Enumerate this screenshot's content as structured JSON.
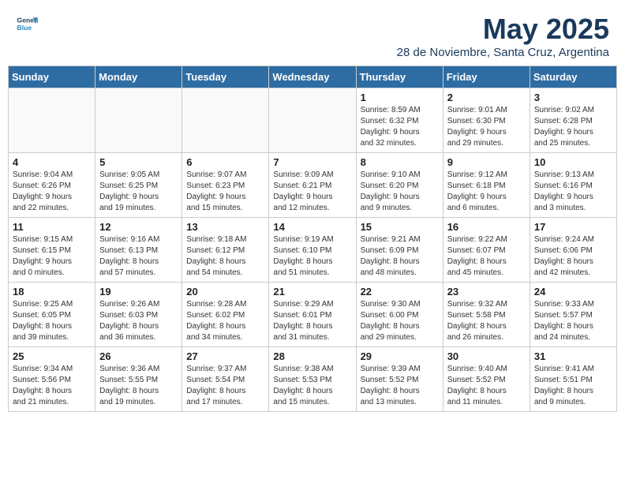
{
  "header": {
    "logo_line1": "General",
    "logo_line2": "Blue",
    "title": "May 2025",
    "location": "28 de Noviembre, Santa Cruz, Argentina"
  },
  "days_of_week": [
    "Sunday",
    "Monday",
    "Tuesday",
    "Wednesday",
    "Thursday",
    "Friday",
    "Saturday"
  ],
  "weeks": [
    [
      {
        "day": "",
        "info": ""
      },
      {
        "day": "",
        "info": ""
      },
      {
        "day": "",
        "info": ""
      },
      {
        "day": "",
        "info": ""
      },
      {
        "day": "1",
        "info": "Sunrise: 8:59 AM\nSunset: 6:32 PM\nDaylight: 9 hours\nand 32 minutes."
      },
      {
        "day": "2",
        "info": "Sunrise: 9:01 AM\nSunset: 6:30 PM\nDaylight: 9 hours\nand 29 minutes."
      },
      {
        "day": "3",
        "info": "Sunrise: 9:02 AM\nSunset: 6:28 PM\nDaylight: 9 hours\nand 25 minutes."
      }
    ],
    [
      {
        "day": "4",
        "info": "Sunrise: 9:04 AM\nSunset: 6:26 PM\nDaylight: 9 hours\nand 22 minutes."
      },
      {
        "day": "5",
        "info": "Sunrise: 9:05 AM\nSunset: 6:25 PM\nDaylight: 9 hours\nand 19 minutes."
      },
      {
        "day": "6",
        "info": "Sunrise: 9:07 AM\nSunset: 6:23 PM\nDaylight: 9 hours\nand 15 minutes."
      },
      {
        "day": "7",
        "info": "Sunrise: 9:09 AM\nSunset: 6:21 PM\nDaylight: 9 hours\nand 12 minutes."
      },
      {
        "day": "8",
        "info": "Sunrise: 9:10 AM\nSunset: 6:20 PM\nDaylight: 9 hours\nand 9 minutes."
      },
      {
        "day": "9",
        "info": "Sunrise: 9:12 AM\nSunset: 6:18 PM\nDaylight: 9 hours\nand 6 minutes."
      },
      {
        "day": "10",
        "info": "Sunrise: 9:13 AM\nSunset: 6:16 PM\nDaylight: 9 hours\nand 3 minutes."
      }
    ],
    [
      {
        "day": "11",
        "info": "Sunrise: 9:15 AM\nSunset: 6:15 PM\nDaylight: 9 hours\nand 0 minutes."
      },
      {
        "day": "12",
        "info": "Sunrise: 9:16 AM\nSunset: 6:13 PM\nDaylight: 8 hours\nand 57 minutes."
      },
      {
        "day": "13",
        "info": "Sunrise: 9:18 AM\nSunset: 6:12 PM\nDaylight: 8 hours\nand 54 minutes."
      },
      {
        "day": "14",
        "info": "Sunrise: 9:19 AM\nSunset: 6:10 PM\nDaylight: 8 hours\nand 51 minutes."
      },
      {
        "day": "15",
        "info": "Sunrise: 9:21 AM\nSunset: 6:09 PM\nDaylight: 8 hours\nand 48 minutes."
      },
      {
        "day": "16",
        "info": "Sunrise: 9:22 AM\nSunset: 6:07 PM\nDaylight: 8 hours\nand 45 minutes."
      },
      {
        "day": "17",
        "info": "Sunrise: 9:24 AM\nSunset: 6:06 PM\nDaylight: 8 hours\nand 42 minutes."
      }
    ],
    [
      {
        "day": "18",
        "info": "Sunrise: 9:25 AM\nSunset: 6:05 PM\nDaylight: 8 hours\nand 39 minutes."
      },
      {
        "day": "19",
        "info": "Sunrise: 9:26 AM\nSunset: 6:03 PM\nDaylight: 8 hours\nand 36 minutes."
      },
      {
        "day": "20",
        "info": "Sunrise: 9:28 AM\nSunset: 6:02 PM\nDaylight: 8 hours\nand 34 minutes."
      },
      {
        "day": "21",
        "info": "Sunrise: 9:29 AM\nSunset: 6:01 PM\nDaylight: 8 hours\nand 31 minutes."
      },
      {
        "day": "22",
        "info": "Sunrise: 9:30 AM\nSunset: 6:00 PM\nDaylight: 8 hours\nand 29 minutes."
      },
      {
        "day": "23",
        "info": "Sunrise: 9:32 AM\nSunset: 5:58 PM\nDaylight: 8 hours\nand 26 minutes."
      },
      {
        "day": "24",
        "info": "Sunrise: 9:33 AM\nSunset: 5:57 PM\nDaylight: 8 hours\nand 24 minutes."
      }
    ],
    [
      {
        "day": "25",
        "info": "Sunrise: 9:34 AM\nSunset: 5:56 PM\nDaylight: 8 hours\nand 21 minutes."
      },
      {
        "day": "26",
        "info": "Sunrise: 9:36 AM\nSunset: 5:55 PM\nDaylight: 8 hours\nand 19 minutes."
      },
      {
        "day": "27",
        "info": "Sunrise: 9:37 AM\nSunset: 5:54 PM\nDaylight: 8 hours\nand 17 minutes."
      },
      {
        "day": "28",
        "info": "Sunrise: 9:38 AM\nSunset: 5:53 PM\nDaylight: 8 hours\nand 15 minutes."
      },
      {
        "day": "29",
        "info": "Sunrise: 9:39 AM\nSunset: 5:52 PM\nDaylight: 8 hours\nand 13 minutes."
      },
      {
        "day": "30",
        "info": "Sunrise: 9:40 AM\nSunset: 5:52 PM\nDaylight: 8 hours\nand 11 minutes."
      },
      {
        "day": "31",
        "info": "Sunrise: 9:41 AM\nSunset: 5:51 PM\nDaylight: 8 hours\nand 9 minutes."
      }
    ]
  ]
}
